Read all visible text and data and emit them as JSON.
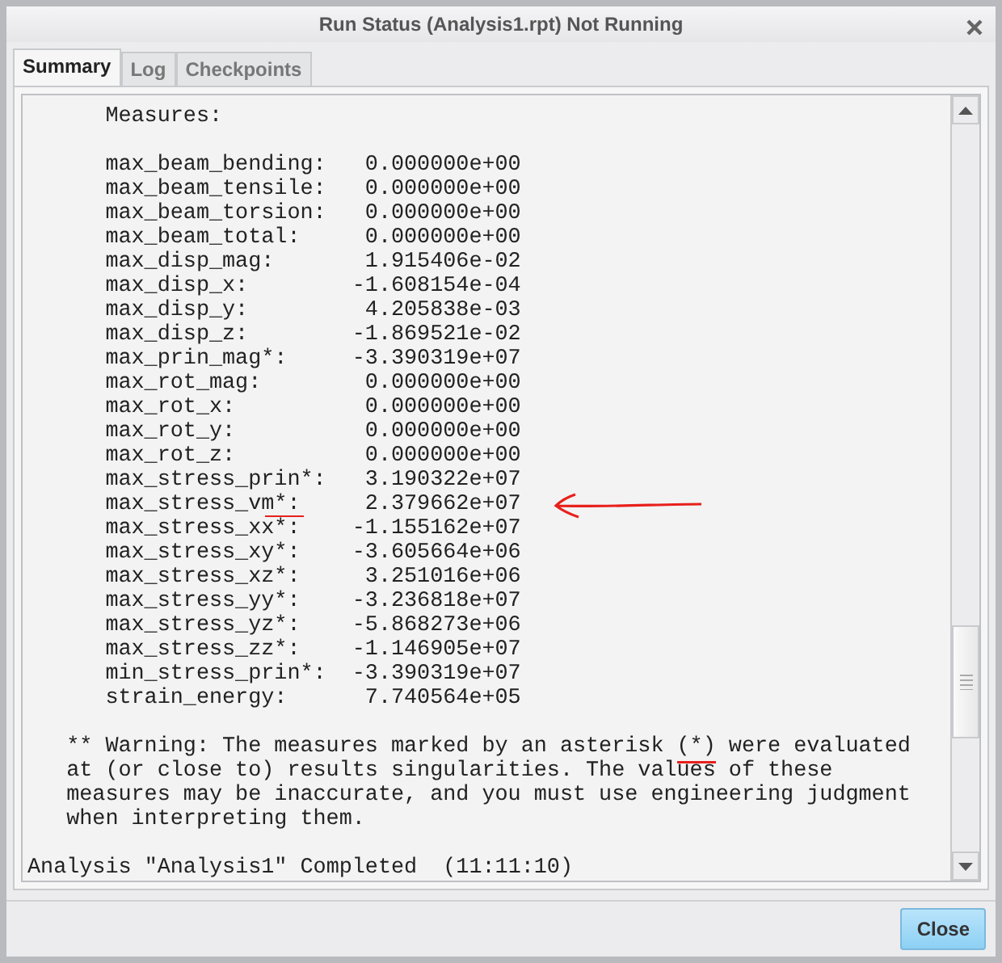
{
  "window": {
    "title": "Run Status (Analysis1.rpt) Not Running"
  },
  "tabs": [
    {
      "label": "Summary",
      "selected": true
    },
    {
      "label": "Log",
      "selected": false
    },
    {
      "label": "Checkpoints",
      "selected": false
    }
  ],
  "report": {
    "heading": "Measures:",
    "rows": [
      {
        "name": "max_beam_bending:",
        "value": " 0.000000e+00",
        "annotated": false
      },
      {
        "name": "max_beam_tensile:",
        "value": " 0.000000e+00",
        "annotated": false
      },
      {
        "name": "max_beam_torsion:",
        "value": " 0.000000e+00",
        "annotated": false
      },
      {
        "name": "max_beam_total:",
        "value": " 0.000000e+00",
        "annotated": false
      },
      {
        "name": "max_disp_mag:",
        "value": " 1.915406e-02",
        "annotated": false
      },
      {
        "name": "max_disp_x:",
        "value": "-1.608154e-04",
        "annotated": false
      },
      {
        "name": "max_disp_y:",
        "value": " 4.205838e-03",
        "annotated": false
      },
      {
        "name": "max_disp_z:",
        "value": "-1.869521e-02",
        "annotated": false
      },
      {
        "name": "max_prin_mag*:",
        "value": "-3.390319e+07",
        "annotated": false
      },
      {
        "name": "max_rot_mag:",
        "value": " 0.000000e+00",
        "annotated": false
      },
      {
        "name": "max_rot_x:",
        "value": " 0.000000e+00",
        "annotated": false
      },
      {
        "name": "max_rot_y:",
        "value": " 0.000000e+00",
        "annotated": false
      },
      {
        "name": "max_rot_z:",
        "value": " 0.000000e+00",
        "annotated": false
      },
      {
        "name": "max_stress_prin*:",
        "value": " 3.190322e+07",
        "annotated": false
      },
      {
        "name": "max_stress_vm*:",
        "value": " 2.379662e+07",
        "annotated": true
      },
      {
        "name": "max_stress_xx*:",
        "value": "-1.155162e+07",
        "annotated": false
      },
      {
        "name": "max_stress_xy*:",
        "value": "-3.605664e+06",
        "annotated": false
      },
      {
        "name": "max_stress_xz*:",
        "value": " 3.251016e+06",
        "annotated": false
      },
      {
        "name": "max_stress_yy*:",
        "value": "-3.236818e+07",
        "annotated": false
      },
      {
        "name": "max_stress_yz*:",
        "value": "-5.868273e+06",
        "annotated": false
      },
      {
        "name": "max_stress_zz*:",
        "value": "-1.146905e+07",
        "annotated": false
      },
      {
        "name": "min_stress_prin*:",
        "value": "-3.390319e+07",
        "annotated": false
      },
      {
        "name": "strain_energy:",
        "value": " 7.740564e+05",
        "annotated": false
      }
    ],
    "warning": "** Warning: The measures marked by an asterisk (*) were evaluated\nat (or close to) results singularities. The values of these\nmeasures may be inaccurate, and you must use engineering judgment\nwhen interpreting them.",
    "status": "Analysis \"Analysis1\" Completed  (11:11:10)"
  },
  "buttons": [
    "Close"
  ]
}
